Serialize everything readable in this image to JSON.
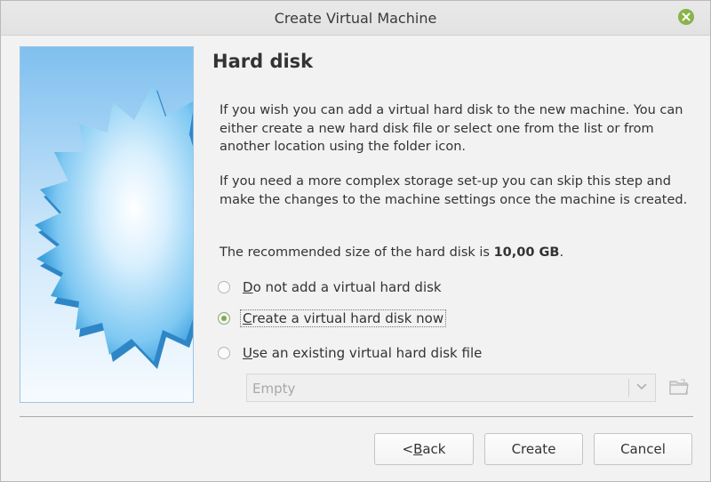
{
  "window": {
    "title": "Create Virtual Machine"
  },
  "page": {
    "heading": "Hard disk",
    "paragraph1": "If you wish you can add a virtual hard disk to the new machine. You can either create a new hard disk file or select one from the list or from another location using the folder icon.",
    "paragraph2": "If you need a more complex storage set-up you can skip this step and make the changes to the machine settings once the machine is created.",
    "recommended_prefix": "The recommended size of the hard disk is ",
    "recommended_size": "10,00 GB",
    "recommended_suffix": "."
  },
  "options": {
    "none": {
      "mnemonic": "D",
      "rest": "o not add a virtual hard disk",
      "checked": false
    },
    "create": {
      "mnemonic": "C",
      "rest": "reate a virtual hard disk now",
      "checked": true
    },
    "existing": {
      "mnemonic": "U",
      "rest": "se an existing virtual hard disk file",
      "checked": false
    }
  },
  "disk_select": {
    "value": "Empty",
    "enabled": false
  },
  "buttons": {
    "back_prefix": "< ",
    "back_mnemonic": "B",
    "back_rest": "ack",
    "create": "Create",
    "cancel": "Cancel"
  },
  "icons": {
    "close": "close-icon",
    "folder": "folder-icon",
    "dropdown": "chevron-down-icon"
  },
  "colors": {
    "accent_green": "#8ab34a",
    "radio_checked": "#7ea85a",
    "side_image_blue": "#4aaee8"
  }
}
